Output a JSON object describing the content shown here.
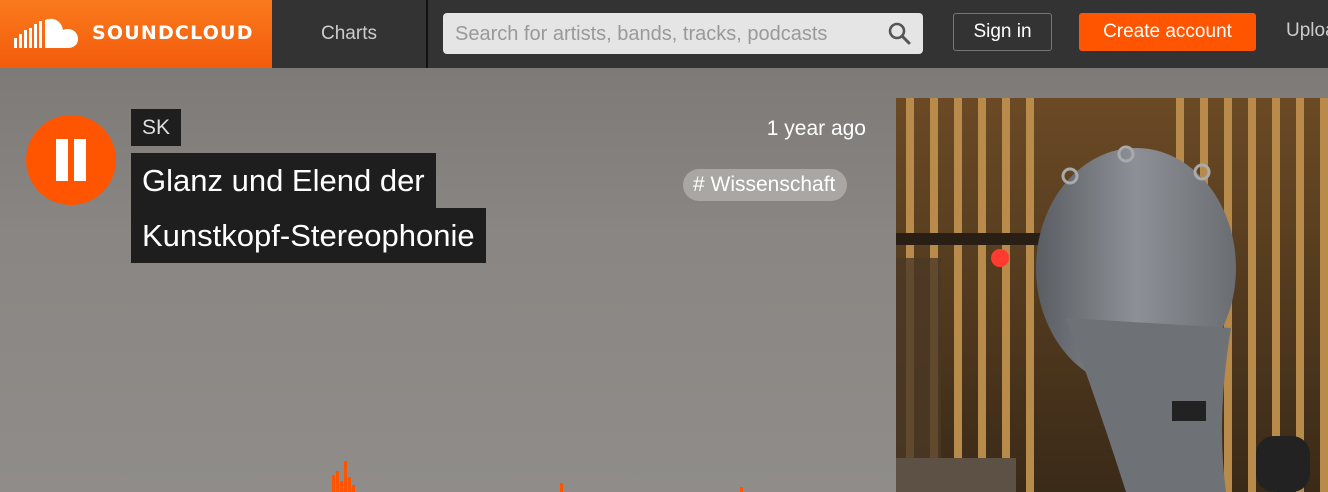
{
  "header": {
    "logo_text": "SOUNDCLOUD",
    "nav_charts": "Charts",
    "search_placeholder": "Search for artists, bands, tracks, podcasts",
    "search_value": "",
    "sign_in": "Sign in",
    "create_account": "Create account",
    "upload": "Upload"
  },
  "track": {
    "artist": "SK",
    "title_line1": "Glanz und Elend der",
    "title_line2": "Kunstkopf-Stereophonie",
    "posted": "1 year ago",
    "tag": "# Wissenschaft",
    "state": "playing"
  },
  "colors": {
    "brand": "#ff5500",
    "header_bg": "#333333"
  },
  "icons": [
    "soundcloud-logo-icon",
    "search-icon",
    "pause-icon"
  ]
}
